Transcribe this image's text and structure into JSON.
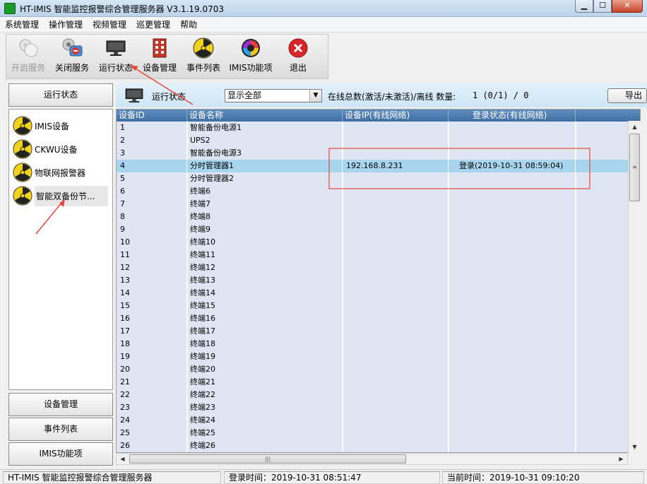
{
  "window": {
    "title": "HT-IMIS 智能监控报警综合管理服务器 V3.1.19.0703",
    "minimize": "▁",
    "maximize": "☐",
    "close": "✕"
  },
  "menu": [
    "系统管理",
    "操作管理",
    "视频管理",
    "巡更管理",
    "帮助"
  ],
  "toolbar": [
    {
      "label": "开启服务",
      "icon": "start-service-icon",
      "disabled": true
    },
    {
      "label": "关闭服务",
      "icon": "stop-service-icon"
    },
    {
      "label": "运行状态",
      "icon": "monitor-icon"
    },
    {
      "label": "设备管理",
      "icon": "device-manager-icon"
    },
    {
      "label": "事件列表",
      "icon": "radiation-icon"
    },
    {
      "label": "IMIS功能项",
      "icon": "color-wheel-icon"
    },
    {
      "label": "退出",
      "icon": "exit-icon"
    }
  ],
  "left": {
    "top_button": "运行状态",
    "devices": [
      "IMIS设备",
      "CKWU设备",
      "物联网报警器",
      "智能双备份节..."
    ],
    "bottom_buttons": [
      "设备管理",
      "事件列表",
      "IMIS功能项"
    ]
  },
  "strip": {
    "title": "运行状态",
    "filter_value": "显示全部",
    "online_label": "在线总数(激活/未激活)/离线 数量:",
    "online_count": "1 (0/1) / 0",
    "export_label": "导出"
  },
  "table": {
    "columns": [
      "设备ID",
      "设备名称",
      "设备IP(有线网络)",
      "登录状态(有线网络)"
    ],
    "rows": [
      [
        "1",
        "智能备份电源1",
        "",
        ""
      ],
      [
        "2",
        "UPS2",
        "",
        ""
      ],
      [
        "3",
        "智能备份电源3",
        "",
        ""
      ],
      [
        "4",
        "分时管理器1",
        "192.168.8.231",
        "登录(2019-10-31 08:59:04)"
      ],
      [
        "5",
        "分时管理器2",
        "",
        ""
      ],
      [
        "6",
        "终端6",
        "",
        ""
      ],
      [
        "7",
        "终端7",
        "",
        ""
      ],
      [
        "8",
        "终端8",
        "",
        ""
      ],
      [
        "9",
        "终端9",
        "",
        ""
      ],
      [
        "10",
        "终端10",
        "",
        ""
      ],
      [
        "11",
        "终端11",
        "",
        ""
      ],
      [
        "12",
        "终端12",
        "",
        ""
      ],
      [
        "13",
        "终端13",
        "",
        ""
      ],
      [
        "14",
        "终端14",
        "",
        ""
      ],
      [
        "15",
        "终端15",
        "",
        ""
      ],
      [
        "16",
        "终端16",
        "",
        ""
      ],
      [
        "17",
        "终端17",
        "",
        ""
      ],
      [
        "18",
        "终端18",
        "",
        ""
      ],
      [
        "19",
        "终端19",
        "",
        ""
      ],
      [
        "20",
        "终端20",
        "",
        ""
      ],
      [
        "21",
        "终端21",
        "",
        ""
      ],
      [
        "22",
        "终端22",
        "",
        ""
      ],
      [
        "23",
        "终端23",
        "",
        ""
      ],
      [
        "24",
        "终端24",
        "",
        ""
      ],
      [
        "25",
        "终端25",
        "",
        ""
      ],
      [
        "26",
        "终端26",
        "",
        ""
      ]
    ],
    "selected_row": 3
  },
  "statusbar": {
    "app": "HT-IMIS 智能监控报警综合管理服务器",
    "login_time": "登录时间：2019-10-31 08:51:47",
    "current_time": "当前时间：2019-10-31 09:10:20"
  },
  "colors": {
    "header": "#4a78ab",
    "selected_row": "#a9d6ef",
    "grid_bg": "#dfe5f2",
    "annotation": "#e8463a"
  }
}
